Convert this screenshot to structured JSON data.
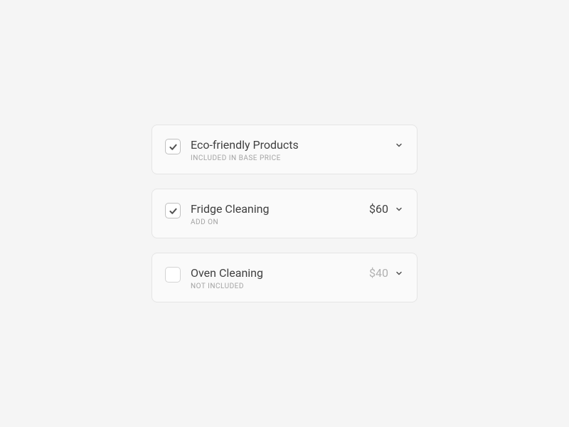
{
  "items": [
    {
      "title": "Eco-friendly Products",
      "subtitle": "INCLUDED IN BASE PRICE",
      "checked": true,
      "price": "",
      "priceMuted": false
    },
    {
      "title": "Fridge Cleaning",
      "subtitle": "ADD ON",
      "checked": true,
      "price": "$60",
      "priceMuted": false
    },
    {
      "title": "Oven Cleaning",
      "subtitle": "NOT INCLUDED",
      "checked": false,
      "price": "$40",
      "priceMuted": true
    }
  ]
}
